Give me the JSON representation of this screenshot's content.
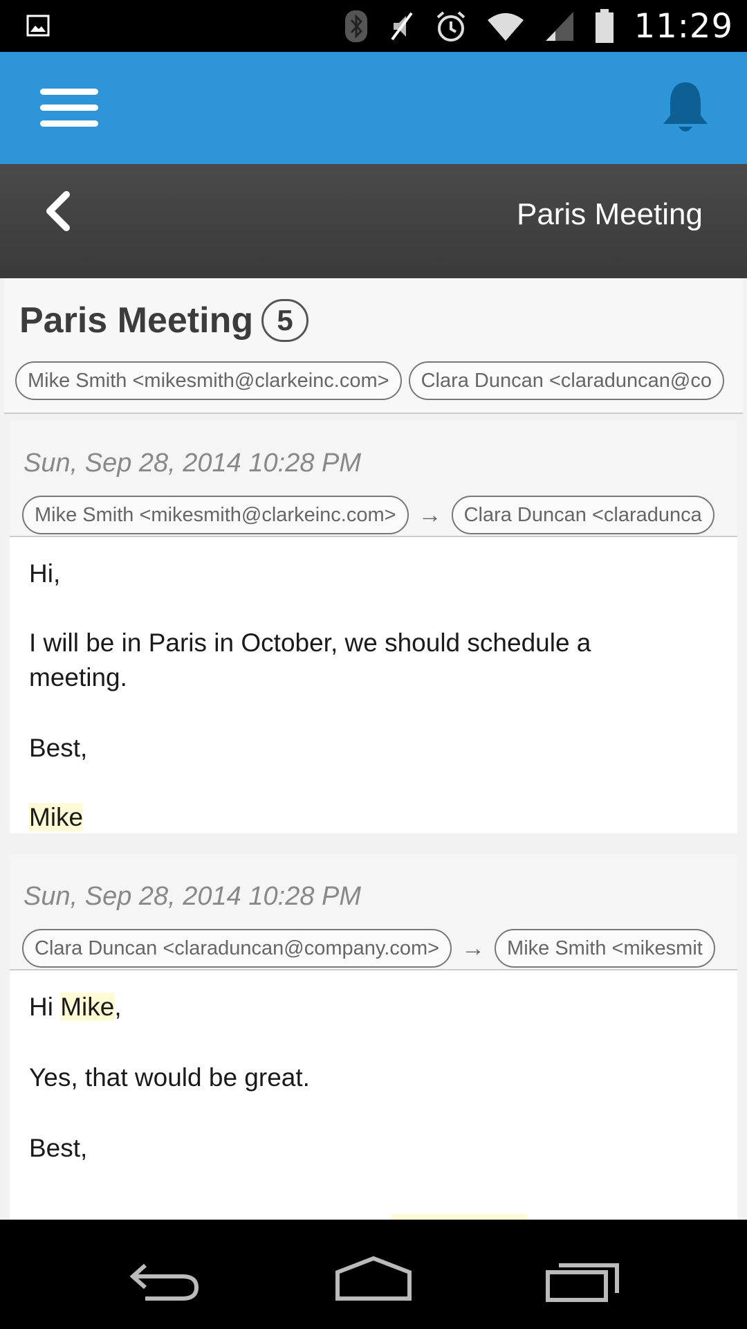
{
  "status_bar": {
    "time": "11:29",
    "icons": [
      "image-notification-icon",
      "bluetooth-icon",
      "mute-icon",
      "alarm-icon",
      "wifi-icon",
      "signal-icon",
      "battery-icon"
    ]
  },
  "app_bar": {
    "color": "#2d95d8",
    "icons": [
      "menu-icon",
      "bell-icon"
    ]
  },
  "sub_header": {
    "title": "Paris Meeting"
  },
  "thread": {
    "title": "Paris Meeting",
    "count": "5",
    "participants": [
      "Mike Smith <mikesmith@clarkeinc.com>",
      "Clara Duncan <claraduncan@co"
    ]
  },
  "messages": [
    {
      "date": "Sun, Sep 28, 2014 10:28 PM",
      "from": "Mike Smith <mikesmith@clarkeinc.com>",
      "arrow": "→",
      "to": "Clara Duncan <claradunca",
      "lines": {
        "greeting": "Hi,",
        "body": "I will be in Paris in October, we should schedule a meeting.",
        "closing": "Best,",
        "signature": "Mike"
      }
    },
    {
      "date": "Sun, Sep 28, 2014 10:28 PM",
      "from": "Clara Duncan <claraduncan@company.com>",
      "arrow": "→",
      "to": "Mike Smith <mikesmit",
      "lines": {
        "greeting_prefix": "Hi ",
        "greeting_name": "Mike",
        "greeting_suffix": ",",
        "body": "Yes, that would be great.",
        "closing": "Best,"
      }
    }
  ],
  "nav_bar": {
    "icons": [
      "back-nav-icon",
      "home-nav-icon",
      "recents-nav-icon"
    ]
  }
}
